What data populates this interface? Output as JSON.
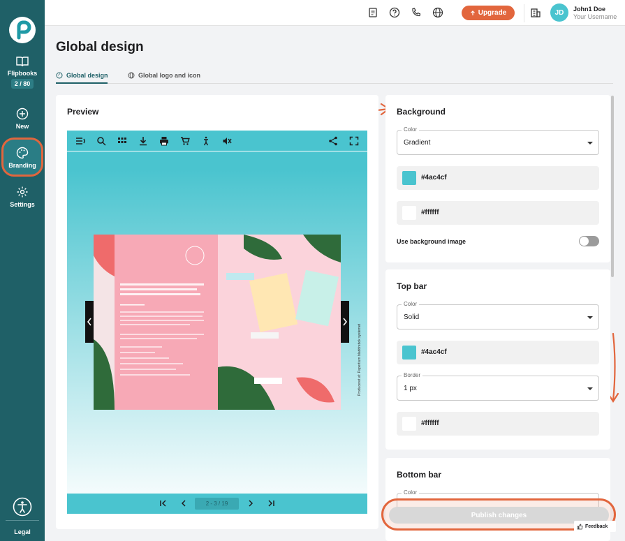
{
  "sidebar": {
    "items": [
      {
        "label": "Flipbooks",
        "badge": "2 / 80",
        "icon": "book-open-icon"
      },
      {
        "label": "New",
        "icon": "plus-circle-icon"
      },
      {
        "label": "Branding",
        "icon": "palette-icon"
      },
      {
        "label": "Settings",
        "icon": "gear-icon"
      }
    ],
    "legal_label": "Legal"
  },
  "topbar": {
    "upgrade_label": "Upgrade",
    "user_initials": "JD",
    "user_name": "John1 Doe",
    "user_sub": "Your Username"
  },
  "header": {
    "title": "Global design",
    "tabs": [
      {
        "label": "Global design"
      },
      {
        "label": "Global logo and icon"
      }
    ]
  },
  "preview": {
    "title": "Preview",
    "pager": "2 - 3 / 19",
    "credit": "Produceret af: Papertium bladdrebok systemet"
  },
  "background": {
    "title": "Background",
    "color_label": "Color",
    "color_mode": "Gradient",
    "color1": "#4ac4cf",
    "color2": "#ffffff",
    "bg_image_label": "Use background image",
    "bg_image_enabled": false
  },
  "top_bar": {
    "title": "Top bar",
    "color_label": "Color",
    "color_mode": "Solid",
    "color": "#4ac4cf",
    "border_label": "Border",
    "border_value": "1 px",
    "border_color": "#ffffff"
  },
  "bottom_bar": {
    "title": "Bottom bar",
    "color_label": "Color"
  },
  "actions": {
    "publish_label": "Publish changes",
    "feedback_label": "Feedback"
  },
  "colors": {
    "accent": "#e2663d",
    "sidebar": "#1f6067",
    "brand_teal": "#4ac4cf"
  }
}
